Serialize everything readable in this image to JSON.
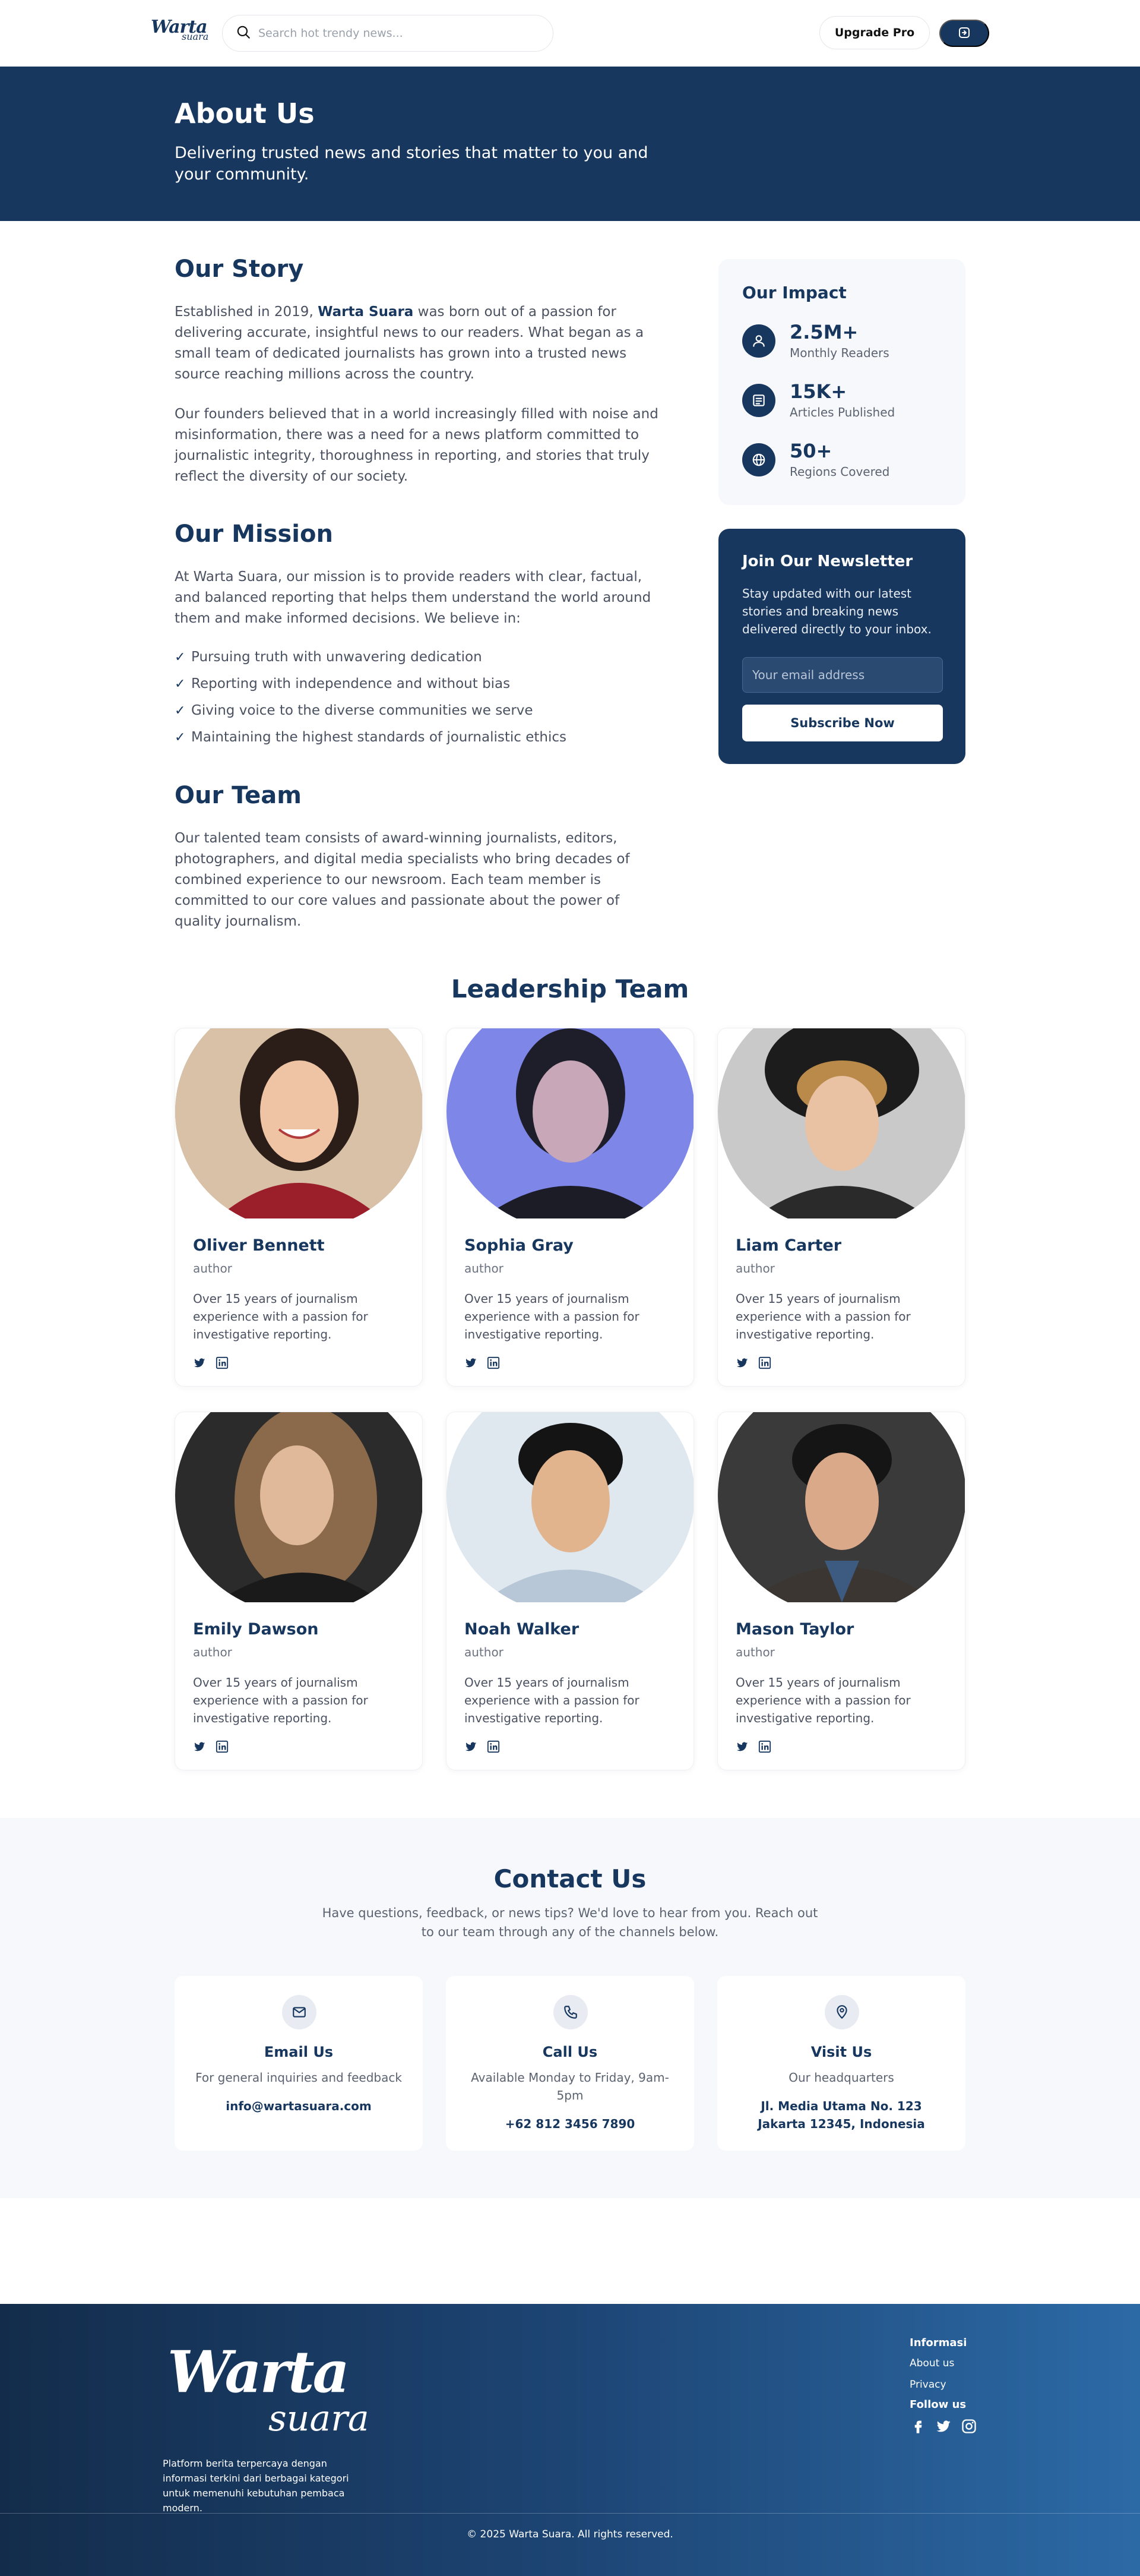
{
  "header": {
    "logo_main": "Warta",
    "logo_sub": "suara",
    "search_placeholder": "Search hot trendy news...",
    "upgrade_label": "Upgrade Pro",
    "login_icon": "login-icon"
  },
  "hero": {
    "title": "About Us",
    "subtitle": "Delivering trusted news and stories that matter to you and your community."
  },
  "story": {
    "title": "Our Story",
    "p1_before": "Established in 2019, ",
    "p1_brand": "Warta Suara",
    "p1_after": " was born out of a passion for delivering accurate, insightful news to our readers. What began as a small team of dedicated journalists has grown into a trusted news source reaching millions across the country.",
    "p2": "Our founders believed that in a world increasingly filled with noise and misinformation, there was a need for a news platform committed to journalistic integrity, thoroughness in reporting, and stories that truly reflect the diversity of our society."
  },
  "mission": {
    "title": "Our Mission",
    "intro": "At Warta Suara, our mission is to provide readers with clear, factual, and balanced reporting that helps them understand the world around them and make informed decisions. We believe in:",
    "points": [
      "Pursuing truth with unwavering dedication",
      "Reporting with independence and without bias",
      "Giving voice to the diverse communities we serve",
      "Maintaining the highest standards of journalistic ethics"
    ]
  },
  "team": {
    "title": "Our Team",
    "text": "Our talented team consists of award-winning journalists, editors, photographers, and digital media specialists who bring decades of combined experience to our newsroom. Each team member is committed to our core values and passionate about the power of quality journalism."
  },
  "impact": {
    "title": "Our Impact",
    "stats": [
      {
        "value": "2.5M+",
        "label": "Monthly Readers",
        "icon": "users-icon"
      },
      {
        "value": "15K+",
        "label": "Articles Published",
        "icon": "newspaper-icon"
      },
      {
        "value": "50+",
        "label": "Regions Covered",
        "icon": "globe-icon"
      }
    ]
  },
  "newsletter": {
    "title": "Join Our Newsletter",
    "text": "Stay updated with our latest stories and breaking news delivered directly to your inbox.",
    "placeholder": "Your email address",
    "button": "Subscribe Now"
  },
  "leadership": {
    "title": "Leadership Team",
    "members": [
      {
        "name": "Oliver Bennett",
        "role": "author",
        "bio": "Over 15 years of journalism experience with a passion for investigative reporting."
      },
      {
        "name": "Sophia Gray",
        "role": "author",
        "bio": "Over 15 years of journalism experience with a passion for investigative reporting."
      },
      {
        "name": "Liam Carter",
        "role": "author",
        "bio": "Over 15 years of journalism experience with a passion for investigative reporting."
      },
      {
        "name": "Emily Dawson",
        "role": "author",
        "bio": "Over 15 years of journalism experience with a passion for investigative reporting."
      },
      {
        "name": "Noah Walker",
        "role": "author",
        "bio": "Over 15 years of journalism experience with a passion for investigative reporting."
      },
      {
        "name": "Mason Taylor",
        "role": "author",
        "bio": "Over 15 years of journalism experience with a passion for investigative reporting."
      }
    ]
  },
  "contact": {
    "title": "Contact Us",
    "subtitle": "Have questions, feedback, or news tips? We'd love to hear from you. Reach out to our team through any of the channels below.",
    "cards": [
      {
        "title": "Email Us",
        "desc": "For general inquiries and feedback",
        "value": "info@wartasuara.com",
        "icon": "mail-icon"
      },
      {
        "title": "Call Us",
        "desc": "Available Monday to Friday, 9am-5pm",
        "value": "+62 812 3456 7890",
        "icon": "phone-icon"
      },
      {
        "title": "Visit Us",
        "desc": "Our headquarters",
        "value": "Jl. Media Utama No. 123 Jakarta 12345, Indonesia",
        "icon": "map-pin-icon"
      }
    ]
  },
  "footer": {
    "logo_main": "Warta",
    "logo_sub": "suara",
    "tagline": "Platform berita terpercaya dengan informasi terkini dari berbagai kategori untuk memenuhi kebutuhan pembaca modern.",
    "info_heading": "Informasi",
    "links": [
      "About us",
      "Privacy"
    ],
    "follow_heading": "Follow us",
    "socials": [
      "facebook-icon",
      "twitter-icon",
      "instagram-icon"
    ],
    "copyright": "© 2025 Warta Suara. All rights reserved."
  },
  "colors": {
    "primary": "#17375e",
    "section_bg": "#f6f8fb",
    "text": "#4a5160"
  }
}
